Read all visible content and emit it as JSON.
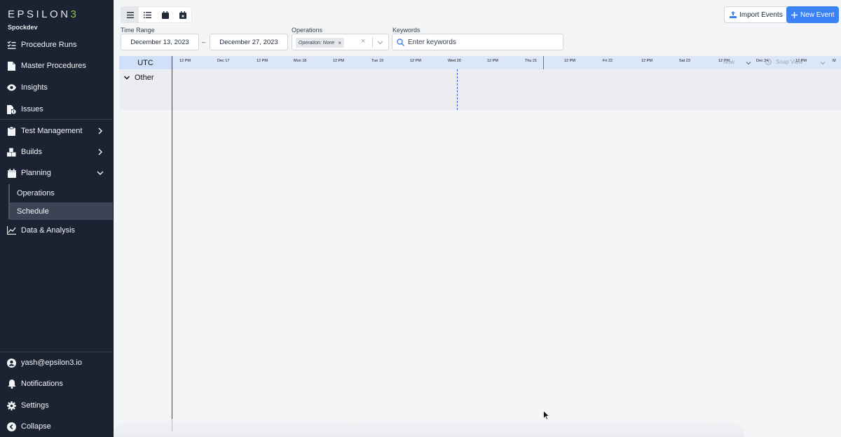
{
  "brand": {
    "logo_text": "EPSILON",
    "logo_accent": "3",
    "workspace": "Spockdev"
  },
  "sidebar": {
    "items": [
      {
        "label": "Procedure Runs",
        "icon": "list-check-icon"
      },
      {
        "label": "Master Procedures",
        "icon": "document-icon"
      },
      {
        "label": "Insights",
        "icon": "eye-icon"
      },
      {
        "label": "Issues",
        "icon": "file-alert-icon"
      },
      {
        "label": "Test Management",
        "icon": "clipboard-icon"
      },
      {
        "label": "Builds",
        "icon": "cubes-icon"
      },
      {
        "label": "Planning",
        "icon": "calendar-icon"
      },
      {
        "label": "Data & Analysis",
        "icon": "line-chart-icon"
      }
    ],
    "planning_sub": [
      {
        "label": "Operations"
      },
      {
        "label": "Schedule"
      }
    ],
    "bottom": [
      {
        "label": "yash@epsilon3.io",
        "icon": "user-circle-icon"
      },
      {
        "label": "Notifications",
        "icon": "bell-icon"
      },
      {
        "label": "Settings",
        "icon": "gear-icon"
      },
      {
        "label": "Collapse",
        "icon": "chevron-left-circle-icon"
      }
    ]
  },
  "toolbar": {
    "import_label": "Import Events",
    "new_label": "New Event"
  },
  "filters": {
    "time_range_label": "Time Range",
    "start_date": "December 13, 2023",
    "separator": "–",
    "end_date": "December 27, 2023",
    "operations_label": "Operations",
    "operation_chip": "Operation: None",
    "keywords_label": "Keywords",
    "keywords_placeholder": "Enter keywords"
  },
  "timeline": {
    "timezone": "UTC",
    "ticks": [
      "12 PM",
      "Dec 17",
      "12 PM",
      "Mon 18",
      "12 PM",
      "Tue 19",
      "12 PM",
      "Wed 20",
      "12 PM",
      "Thu 21",
      "12 PM",
      "Fri 22",
      "12 PM",
      "Sat 23",
      "12 PM",
      "Dec 24",
      "12 PM",
      "M"
    ],
    "now_label": "Now",
    "snap_label": "Snap View",
    "group_label": "Other"
  },
  "colors": {
    "sidebar_bg": "#1b2333",
    "accent": "#3b82f6",
    "logo_accent": "#8bc34a"
  }
}
